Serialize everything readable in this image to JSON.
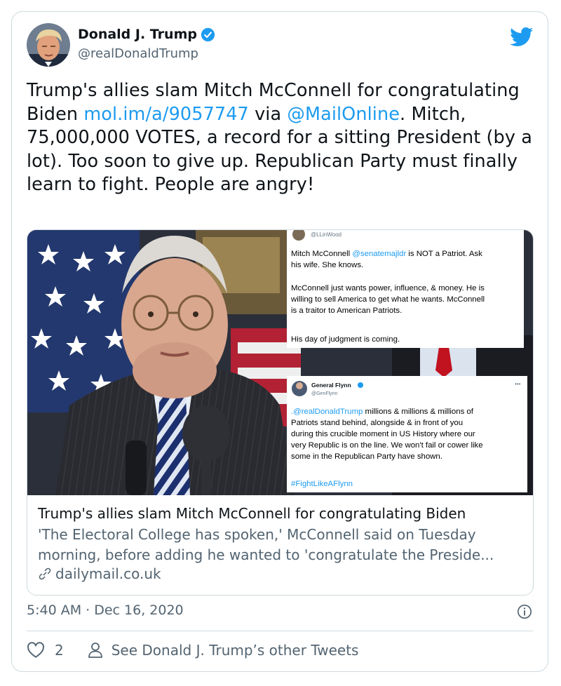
{
  "author": {
    "name": "Donald J. Trump",
    "handle": "@realDonaldTrump",
    "verified": true
  },
  "tweet": {
    "text_1": "Trump's allies slam Mitch McConnell for congratulating Biden ",
    "link": "mol.im/a/9057747",
    "text_2": " via ",
    "mention": "@MailOnline",
    "text_3": ". Mitch, 75,000,000 VOTES, a record for a sitting President (by a lot). Too soon to give up. Republican Party must finally learn to fight. People are angry!"
  },
  "link_card": {
    "title": "Trump's allies slam Mitch McConnell for congratulating Biden",
    "description": "'The Electoral College has spoken,' McConnell said on Tuesday morning, before adding he wanted to 'congratulate the Preside...",
    "domain": "dailymail.co.uk",
    "embedded_tweet_1": {
      "handle": "@LLinWood",
      "p1_a": "Mitch McConnell ",
      "p1_mention": "@senatemajldr",
      "p1_b": " is NOT a Patriot. Ask",
      "p1_line2": "his wife. She knows.",
      "p2_line1": "McConnell just wants power, influence, & money. He is",
      "p2_line2": "willing to sell America to get what he wants. McConnell",
      "p2_line3": "is a traitor to American Patriots.",
      "p3": "His day of judgment is coming."
    },
    "embedded_tweet_2": {
      "name": "General Flynn",
      "handle": "@GenFlynn",
      "more": "•••",
      "mention": ".@realDonaldTrump",
      "line1_rest": " millions & millions & millions of",
      "line2": "Patriots stand behind, alongside & in front of you",
      "line3": "during this crucible moment in US History where our",
      "line4": "very Republic is on the line. We won't fail or cower like",
      "line5": "some in the Republican Party have shown.",
      "hashtag": "#FightLikeAFlynn"
    }
  },
  "timestamp": "5:40 AM · Dec 16, 2020",
  "actions": {
    "like_count": "2",
    "other_tweets_label": "See Donald J. Trump’s other Tweets"
  },
  "colors": {
    "link": "#1d9bf0",
    "text": "#0f1419",
    "secondary": "#536471",
    "border": "#cfd9de"
  },
  "icons": [
    "verified-badge-icon",
    "twitter-bird-icon",
    "link-icon",
    "info-icon",
    "heart-icon",
    "person-icon"
  ]
}
